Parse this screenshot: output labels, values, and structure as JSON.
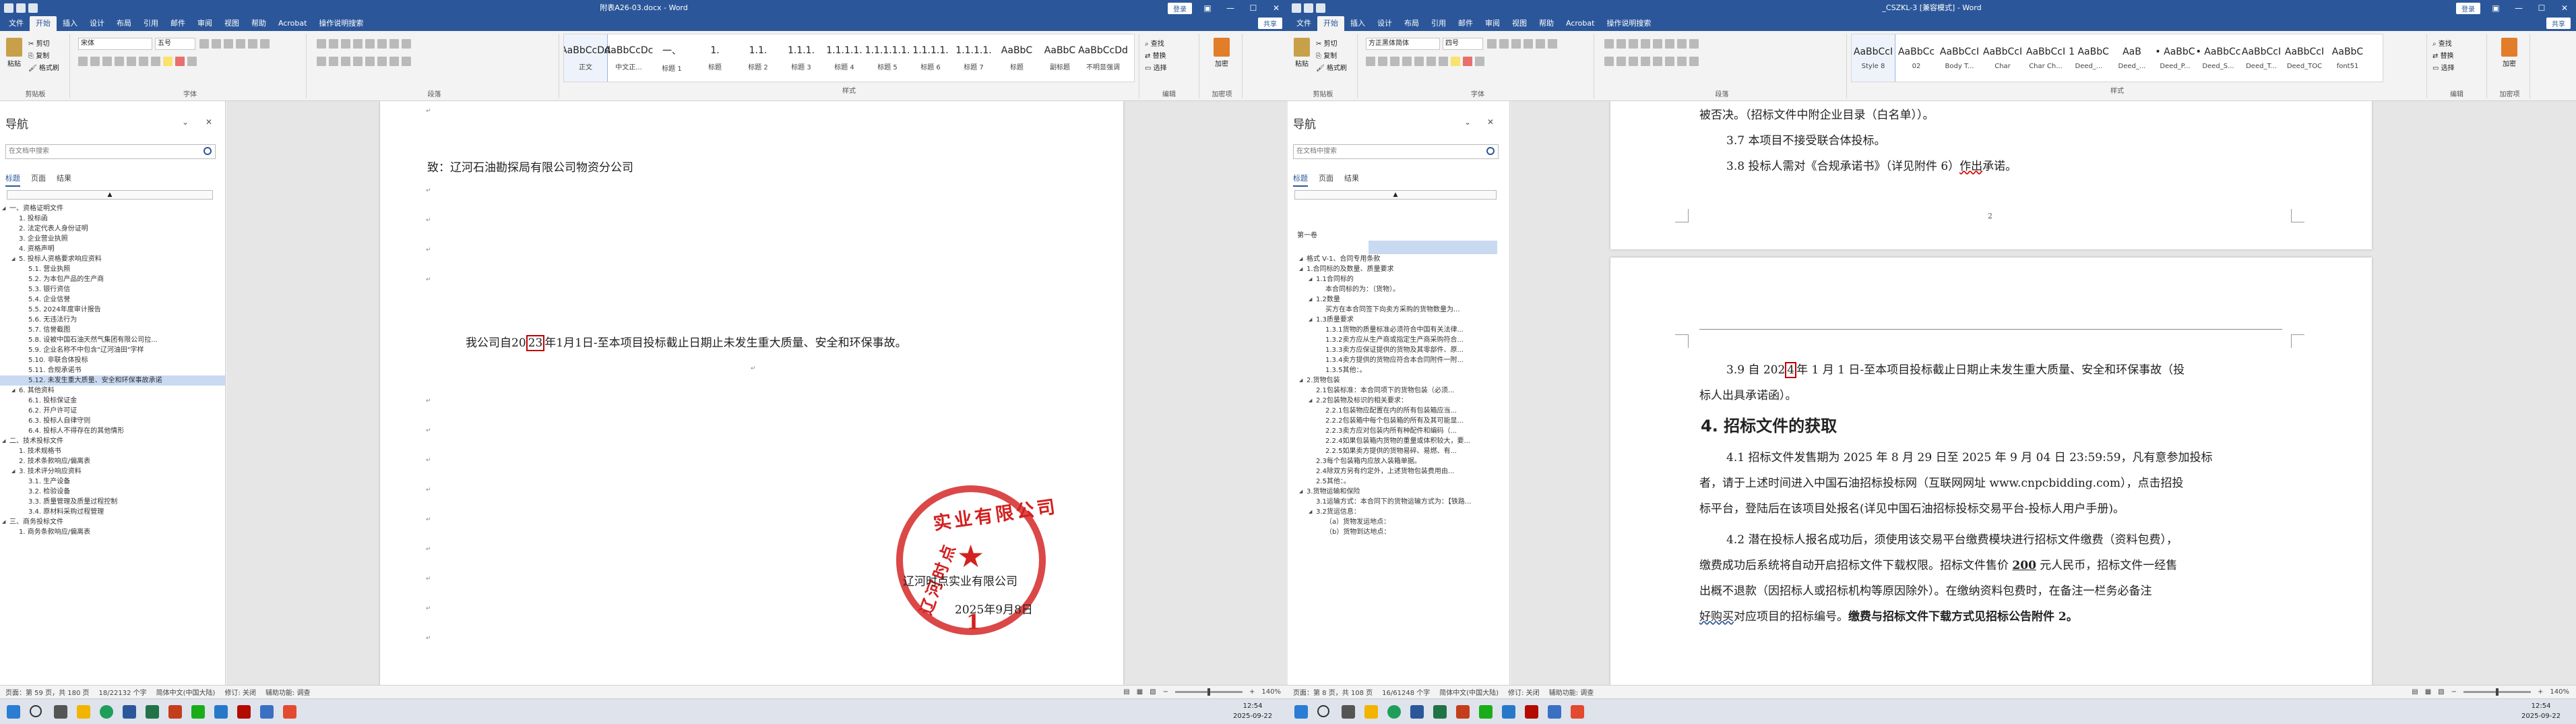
{
  "left_window": {
    "title": "附表A26-03.docx - Word",
    "login": "登录",
    "menu": [
      "文件",
      "开始",
      "插入",
      "设计",
      "布局",
      "引用",
      "邮件",
      "审阅",
      "视图",
      "帮助",
      "Acrobat",
      "操作说明搜索"
    ],
    "share": "共享",
    "ribbon": {
      "clipboard": {
        "paste": "粘贴",
        "cut": "剪切",
        "copy": "复制",
        "format_painter": "格式刷",
        "label": "剪贴板"
      },
      "font": {
        "name": "宋体",
        "size": "五号",
        "label": "字体"
      },
      "paragraph_label": "段落",
      "styles_label": "样式",
      "styles": [
        {
          "sample": "AaBbCcDd",
          "name": "正文"
        },
        {
          "sample": "AaBbCcDc",
          "name": "中文正..."
        },
        {
          "sample": "一、",
          "name": "标题 1"
        },
        {
          "sample": "1.",
          "name": "标题"
        },
        {
          "sample": "1.1.",
          "name": "标题 2"
        },
        {
          "sample": "1.1.1.",
          "name": "标题 3"
        },
        {
          "sample": "1.1.1.1.",
          "name": "标题 4"
        },
        {
          "sample": "1.1.1.1.1.",
          "name": "标题 5"
        },
        {
          "sample": "1.1.1.1.",
          "name": "标题 6"
        },
        {
          "sample": "1.1.1.1.",
          "name": "标题 7"
        },
        {
          "sample": "AaBbC",
          "name": "标题"
        },
        {
          "sample": "AaBbC",
          "name": "副标题"
        },
        {
          "sample": "AaBbCcDd",
          "name": "不明显强调"
        }
      ],
      "editing": {
        "find": "查找",
        "replace": "替换",
        "select": "选择",
        "label": "编辑"
      },
      "acrobat": {
        "btn": "加密",
        "label": "加密项"
      }
    },
    "nav": {
      "title": "导航",
      "search_placeholder": "在文档中搜索",
      "tabs": [
        "标题",
        "页面",
        "结果"
      ],
      "scroll_label": "▲",
      "items": [
        {
          "text": "一、资格证明文件",
          "level": 0,
          "exp": true
        },
        {
          "text": "1. 投标函",
          "level": 1
        },
        {
          "text": "2. 法定代表人身份证明",
          "level": 1
        },
        {
          "text": "3. 企业营业执照",
          "level": 1
        },
        {
          "text": "4. 资格声明",
          "level": 1
        },
        {
          "text": "5. 投标人资格要求响应资料",
          "level": 1,
          "exp": true
        },
        {
          "text": "5.1. 营业执照",
          "level": 2
        },
        {
          "text": "5.2. 为本包产品的生产商",
          "level": 2
        },
        {
          "text": "5.3. 银行资信",
          "level": 2
        },
        {
          "text": "5.4. 企业信誉",
          "level": 2
        },
        {
          "text": "5.5. 2024年度审计报告",
          "level": 2
        },
        {
          "text": "5.6. 无违法行为",
          "level": 2
        },
        {
          "text": "5.7. 信誉截图",
          "level": 2
        },
        {
          "text": "5.8. 设被中国石油天然气集团有限公司拉...",
          "level": 2
        },
        {
          "text": "5.9. 企业名称不中包含\"辽河油田\"字样",
          "level": 2
        },
        {
          "text": "5.10. 非联合体投标",
          "level": 2
        },
        {
          "text": "5.11. 合规承诺书",
          "level": 2
        },
        {
          "text": "5.12. 未发生重大质量、安全和环保事故承诺",
          "level": 2,
          "sel": true
        },
        {
          "text": "6. 其他资料",
          "level": 1,
          "exp": true
        },
        {
          "text": "6.1. 投标保证金",
          "level": 2
        },
        {
          "text": "6.2. 开户许可证",
          "level": 2
        },
        {
          "text": "6.3. 投标人自律守则",
          "level": 2
        },
        {
          "text": "6.4. 投标人不得存在的其他情形",
          "level": 2
        },
        {
          "text": "二、技术投标文件",
          "level": 0,
          "exp": true
        },
        {
          "text": "1. 技术规格书",
          "level": 1
        },
        {
          "text": "2. 技术条款响应/偏离表",
          "level": 1
        },
        {
          "text": "3. 技术评分响应资料",
          "level": 1,
          "exp": true
        },
        {
          "text": "3.1. 生产设备",
          "level": 2
        },
        {
          "text": "3.2. 检验设备",
          "level": 2
        },
        {
          "text": "3.3. 质量管理及质量过程控制",
          "level": 2
        },
        {
          "text": "3.4. 原材料采购过程管理",
          "level": 2
        },
        {
          "text": "三、商务投标文件",
          "level": 0,
          "exp": true
        },
        {
          "text": "1. 商务条款响应/偏离表",
          "level": 1
        }
      ]
    },
    "doc": {
      "to_line": "致：辽河石油勘探局有限公司物资分公司",
      "commit_prefix": "我公司自20",
      "commit_highlight": "23",
      "commit_suffix": "年1月1日-至本项目投标截止日期止未发生重大质量、安全和环保事故。",
      "company_overlay": "辽河时点实业有限公司",
      "date_overlay": "2025年9月8日",
      "stamp_top": "实业有限公司",
      "stamp_left": "辽河时点",
      "stamp_bottom": "1"
    },
    "status": {
      "page": "页面：第 59 页，共 180 页",
      "words": "18/22132 个字",
      "lang": "简体中文(中国大陆)",
      "track": "修订: 关闭",
      "access": "辅助功能: 调查",
      "zoom": "140%"
    }
  },
  "right_window": {
    "title": "_CSZKL-3 [兼容模式] - Word",
    "login": "登录",
    "menu": [
      "文件",
      "开始",
      "插入",
      "设计",
      "布局",
      "引用",
      "邮件",
      "审阅",
      "视图",
      "帮助",
      "Acrobat",
      "操作说明搜索"
    ],
    "share": "共享",
    "ribbon": {
      "font": {
        "name": "方正黑体简体",
        "size": "四号"
      },
      "styles": [
        {
          "sample": "AaBbCcI",
          "name": "Style 8"
        },
        {
          "sample": "AaBbCc",
          "name": "02"
        },
        {
          "sample": "AaBbCcI",
          "name": "Body T..."
        },
        {
          "sample": "AaBbCcI",
          "name": "Char"
        },
        {
          "sample": "AaBbCcI",
          "name": "Char Ch..."
        },
        {
          "sample": "1 AaBbC",
          "name": "Deed_..."
        },
        {
          "sample": "AaB",
          "name": "Deed_..."
        },
        {
          "sample": "• AaBbC",
          "name": "Deed_P..."
        },
        {
          "sample": "• AaBbCc",
          "name": "Deed_S..."
        },
        {
          "sample": "AaBbCcI",
          "name": "Deed_T..."
        },
        {
          "sample": "AaBbCcI",
          "name": "Deed_TOC"
        },
        {
          "sample": "AaBbC",
          "name": "font51"
        }
      ],
      "editing": {
        "find": "查找",
        "replace": "替换",
        "select": "选择",
        "label": "编辑"
      },
      "acrobat": {
        "btn": "加密",
        "label": "加密项"
      }
    },
    "nav": {
      "title": "导航",
      "search_placeholder": "在文档中搜索",
      "tabs": [
        "标题",
        "页面",
        "结果"
      ],
      "scroll_label": "▲",
      "items": [
        {
          "text": "第一卷",
          "level": 0
        },
        {
          "text": "",
          "level": 1,
          "sel": true
        },
        {
          "text": "格式 V-1、合同专用条款",
          "level": 1,
          "exp": true
        },
        {
          "text": "1.合同标的及数量、质量要求",
          "level": 1,
          "exp": true
        },
        {
          "text": "1.1合同标的",
          "level": 2,
          "exp": true
        },
        {
          "text": "本合同标的为：（货物）。",
          "level": 3
        },
        {
          "text": "1.2数量",
          "level": 2,
          "exp": true
        },
        {
          "text": "买方在本合同签下向卖方采购的货物数量为...",
          "level": 3
        },
        {
          "text": "1.3质量要求",
          "level": 2,
          "exp": true
        },
        {
          "text": "1.3.1货物的质量标准必须符合中国有关法律...",
          "level": 3
        },
        {
          "text": "1.3.2卖方应从生产商或指定生产商采购符合...",
          "level": 3
        },
        {
          "text": "1.3.3卖方应保证提供的货物及其零部件、原...",
          "level": 3
        },
        {
          "text": "1.3.4卖方提供的货物应符合本合同附件一附...",
          "level": 3
        },
        {
          "text": "1.3.5其他：。",
          "level": 3
        },
        {
          "text": "2.货物包装",
          "level": 1,
          "exp": true
        },
        {
          "text": "2.1包装标准：本合同项下的货物包装（必须...",
          "level": 2
        },
        {
          "text": "2.2包装物及标识的相关要求：",
          "level": 2,
          "exp": true
        },
        {
          "text": "2.2.1包装物应配置在内的所有包装箱应当...",
          "level": 3
        },
        {
          "text": "2.2.2包装箱中每个包装箱的所有及其可能显...",
          "level": 3
        },
        {
          "text": "2.2.3卖方应对包装内所有种配件和编码（...",
          "level": 3
        },
        {
          "text": "2.2.4如果包装箱内货物的重量或体积较大，要...",
          "level": 3
        },
        {
          "text": "2.2.5如果卖方提供的货物易碎、易燃、有...",
          "level": 3
        },
        {
          "text": "2.3每个包装箱内应放入装箱单据。",
          "level": 2
        },
        {
          "text": "2.4除双方另有约定外，上述货物包装费用由...",
          "level": 2
        },
        {
          "text": "2.5其他：。",
          "level": 2
        },
        {
          "text": "3.货物运输和保险",
          "level": 1,
          "exp": true
        },
        {
          "text": "3.1运输方式：本合同下的货物运输方式为：【铁路...",
          "level": 2
        },
        {
          "text": "3.2货运信息：",
          "level": 2,
          "exp": true
        },
        {
          "text": "（a）货物发运地点：",
          "level": 3
        },
        {
          "text": "（b）货物到达地点：",
          "level": 3
        }
      ]
    },
    "doc": {
      "p_top": "被否决。（招标文件中附企业目录（白名单））。",
      "p37": "3.7 本项目不接受联合体投标。",
      "p38_prefix": "3.8 投标人需对《合规承诺书》（详见附件 6）",
      "p38_underline": "作出",
      "p38_suffix": "承诺。",
      "page_num": "2",
      "p39_prefix": "3.9 自 202",
      "p39_highlight": "4",
      "p39_suffix": "年 1 月 1 日-至本项目投标截止日期止未发生重大质量、安全和环保事故（投",
      "p39_line2": "标人出具承诺函）。",
      "heading4": "4. 招标文件的获取",
      "p41_l1": "4.1 招标文件发售期为 2025 年 8 月 29 日至 2025 年 9 月 04 日 23:59:59，凡有意参加投标",
      "p41_l2": "者，请于上述时间进入中国石油招标投标网（互联网网址 www.cnpcbidding.com），点击招投",
      "p41_l3": "标平台，登陆后在该项目处报名(详见中国石油招标投标交易平台-投标人用户手册)。",
      "p42_l1": "4.2 潜在投标人报名成功后，须使用该交易平台缴费模块进行招标文件缴费（资料包费），",
      "p42_l2_a": "缴费成功后系统将自动开启招标文件下载权限。招标文件售价 ",
      "p42_l2_bold": "200",
      "p42_l2_b": " 元人民币，招标文件一经售",
      "p42_l3": "出概不退款（因招标人或招标机构等原因除外）。在缴纳资料包费时，在备注一栏务必备注",
      "p42_l4_a": "好购买",
      "p42_l4_b": "对应项目的招标编号。",
      "p42_l4_bold": "缴费与招标文件下载方式见招标公告附件 2。"
    },
    "status": {
      "page": "页面：第 8 页，共 108 页",
      "words": "16/61248 个字",
      "lang": "简体中文(中国大陆)",
      "track": "修订: 关闭",
      "access": "辅助功能: 调查",
      "zoom": "140%"
    }
  },
  "taskbar": {
    "clock_left": {
      "time": "12:54",
      "date": "2025-09-22"
    },
    "clock_right": {
      "time": "12:54",
      "date": "2025-09-22"
    }
  }
}
